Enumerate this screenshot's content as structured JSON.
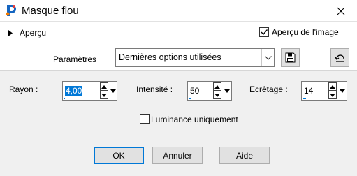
{
  "window": {
    "title": "Masque flou",
    "icon": "paintshop-pro-icon"
  },
  "preview": {
    "label": "Aperçu",
    "image_preview_label": "Aperçu de l'image",
    "image_preview_checked": true
  },
  "settings": {
    "label": "Paramètres",
    "preset_value": "Dernières options utilisées"
  },
  "fields": {
    "rayon": {
      "label": "Rayon :",
      "value": "4,00",
      "level": 0.02
    },
    "intensite": {
      "label": "Intensité :",
      "value": "50",
      "level": 0.1
    },
    "ecretage": {
      "label": "Ecrêtage :",
      "value": "14",
      "level": 0.14
    }
  },
  "luminance": {
    "label": "Luminance uniquement",
    "checked": false
  },
  "buttons": {
    "ok": "OK",
    "cancel": "Annuler",
    "help": "Aide"
  },
  "colors": {
    "accent": "#0078d7",
    "panel_bg": "#ffffff",
    "dialog_bg": "#f0f0f0"
  }
}
